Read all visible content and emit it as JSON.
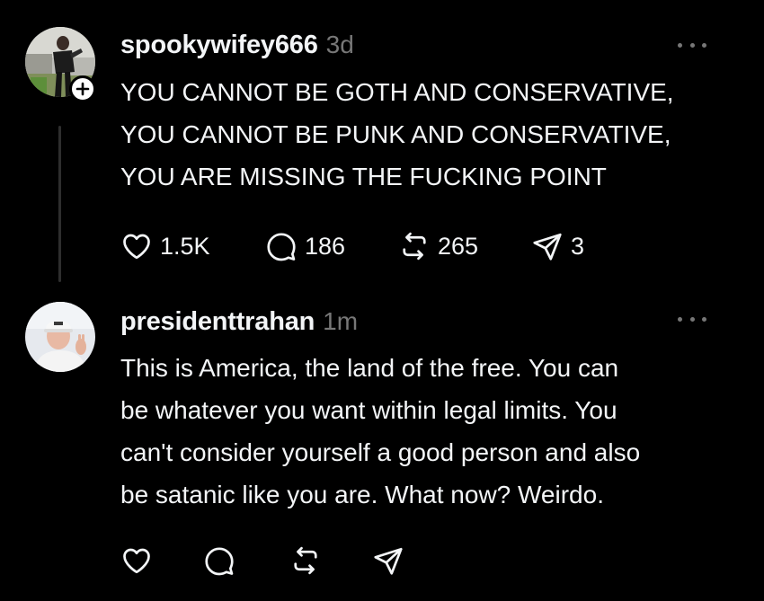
{
  "posts": [
    {
      "username": "spookywifey666",
      "timestamp": "3d",
      "text_lines": [
        "YOU CANNOT BE GOTH AND CONSERVATIVE,",
        "YOU CANNOT BE PUNK AND CONSERVATIVE,",
        "YOU ARE MISSING THE FUCKING POINT"
      ],
      "likes": "1.5K",
      "replies": "186",
      "reposts": "265",
      "shares": "3"
    },
    {
      "username": "presidenttrahan",
      "timestamp": "1m",
      "text_lines": [
        "This is America, the land of the free. You can",
        "be whatever you want within legal limits. You",
        "can't consider yourself a good person and also",
        "be satanic like you are. What now? Weirdo."
      ]
    }
  ],
  "icons": {
    "like": "heart-icon",
    "reply": "speech-bubble-icon",
    "repost": "repost-arrows-icon",
    "share": "paper-plane-icon",
    "more": "ellipsis-icon",
    "follow": "plus-icon"
  },
  "colors": {
    "background": "#000000",
    "primary_text": "#f3f5f7",
    "secondary_text": "#777777",
    "thread_line": "#2e2e2e"
  }
}
